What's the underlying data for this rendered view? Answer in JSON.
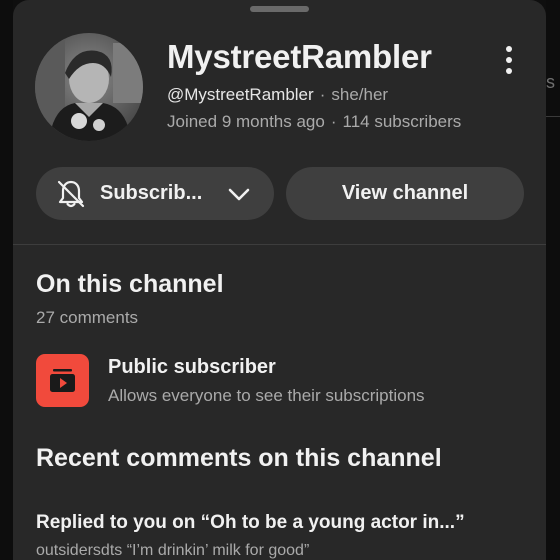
{
  "channel": {
    "name": "MystreetRambler",
    "handle": "@MystreetRambler",
    "pronouns": "she/her",
    "joined": "Joined 9 months ago",
    "subscribers": "114 subscribers",
    "separator": "·"
  },
  "actions": {
    "subscribe_label": "Subscrib...",
    "view_channel_label": "View channel"
  },
  "on_channel": {
    "title": "On this channel",
    "comment_count": "27 comments",
    "public_subscriber_title": "Public subscriber",
    "public_subscriber_desc": "Allows everyone to see their subscriptions"
  },
  "recent": {
    "title": "Recent comments on this channel",
    "comments": [
      {
        "heading": "Replied to you on “Oh to be a young actor in...”",
        "sub": "outsidersdts “I’m drinkin’ milk for good”"
      }
    ]
  },
  "background": {
    "right_edge_glyph": "s"
  },
  "icons": {
    "bell": "bell-off-icon",
    "chevron": "chevron-down-icon",
    "more": "more-vertical-icon",
    "public": "subscriptions-icon"
  },
  "colors": {
    "sheet": "#282828",
    "button": "#3f3f3f",
    "accent": "#f14a3c",
    "text": "#f1f1f1",
    "muted": "#aaaaaa"
  }
}
